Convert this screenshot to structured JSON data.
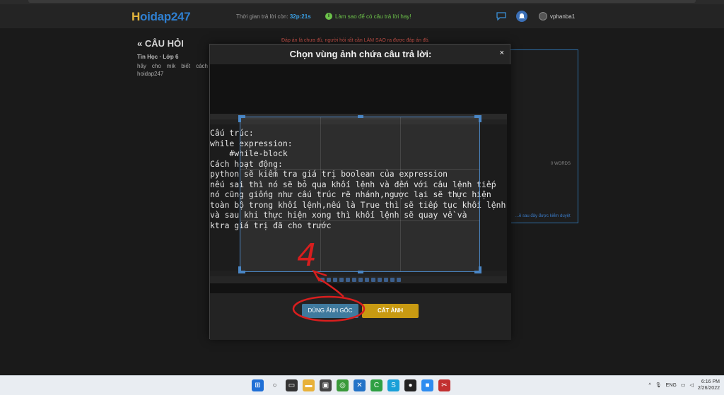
{
  "header": {
    "logo_main": "H",
    "logo_rest": "oidap247",
    "timer_label": "Thời gian trả lời còn: ",
    "timer_value": "32p:21s",
    "help_link": "Làm sao để có câu trả lời hay!",
    "username": "vphanba1"
  },
  "left": {
    "back_title": "CÂU HỎI",
    "subject": "Tin Học · Lớp 6",
    "question": "hãy cho mik biết cách hoidap247"
  },
  "warning": "Đáp án là chưa đủ, người hỏi rất cần LÀM SAO ra được đáp án đó.",
  "right_panel": {
    "words": "0 WORDS",
    "link": "...ề sau đây được kiểm duyệt"
  },
  "modal": {
    "title": "Chọn vùng ảnh chứa câu trả lời:",
    "close": "×",
    "code_lines": [
      "Cấu trúc:",
      "while expression:",
      "    #while-block",
      "Cách hoạt động:",
      "python sẽ kiểm tra giá trị boolean của expression",
      "nếu sai thì nó sẽ bỏ qua khối lệnh và đến với câu lệnh tiếp",
      "nó cũng giống như cấu trúc rẽ nhánh,ngược lại sẽ thực hiện",
      "toàn bộ trong khối lệnh,nếu là True thì sẽ tiếp tục khối lệnh",
      "và sau khi thực hiện xong thì khối lệnh sẽ quay về và",
      "ktra giá trị đã cho trước"
    ],
    "btn_original": "DÙNG ẢNH GỐC",
    "btn_crop": "CẮT ẢNH"
  },
  "annotation": {
    "number": "4",
    "color": "#d81e1e"
  },
  "taskbar": {
    "lang": "ENG",
    "time": "6:16 PM",
    "date": "2/26/2022"
  }
}
